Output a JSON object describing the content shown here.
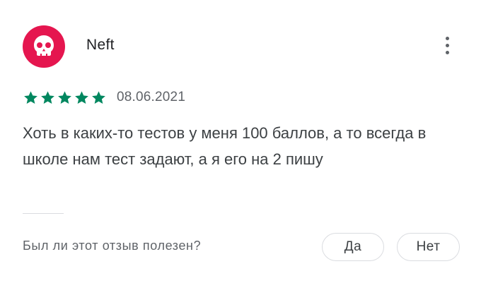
{
  "review": {
    "author": "Neft",
    "avatar_icon": "skull-icon",
    "avatar_color": "#e5164f",
    "rating": 5,
    "rating_max": 5,
    "star_color": "#01875f",
    "date": "08.06.2021",
    "text": "Хоть в каких-то тестов у меня 100 баллов, а то всегда в школе нам тест задают, а я его на 2 пишу"
  },
  "feedback": {
    "question": "Был ли этот отзыв полезен?",
    "yes_label": "Да",
    "no_label": "Нет"
  },
  "menu_icon": "more-vert-icon"
}
